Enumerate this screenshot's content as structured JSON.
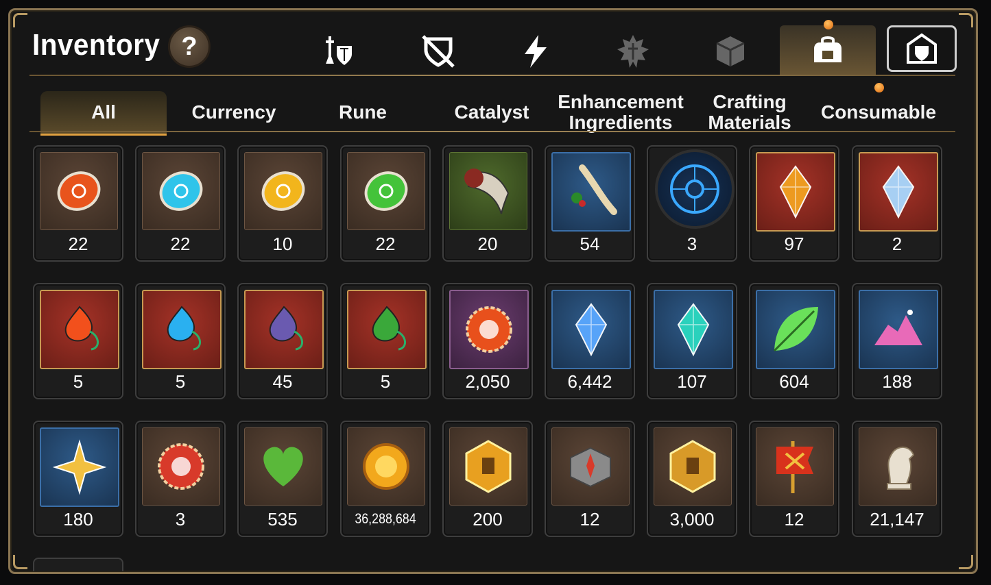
{
  "header": {
    "title": "Inventory",
    "help_label": "?",
    "icons": [
      {
        "name": "sword-shield-icon"
      },
      {
        "name": "broken-shield-icon"
      },
      {
        "name": "lightning-icon"
      },
      {
        "name": "spiked-emblem-icon"
      },
      {
        "name": "cube-icon"
      },
      {
        "name": "backpack-icon",
        "active": true,
        "badge": true
      },
      {
        "name": "castle-shield-icon"
      }
    ]
  },
  "tabs": [
    {
      "label": "All",
      "active": true
    },
    {
      "label": "Currency"
    },
    {
      "label": "Rune"
    },
    {
      "label": "Catalyst"
    },
    {
      "label": "Enhancement Ingredients"
    },
    {
      "label": "Crafting Materials"
    },
    {
      "label": "Consumable",
      "badge": true
    }
  ],
  "items": [
    {
      "name": "fire-rune-stone-icon",
      "qty": "22",
      "bg": "brown",
      "c": "#e8541c"
    },
    {
      "name": "ice-rune-stone-icon",
      "qty": "22",
      "bg": "brown",
      "c": "#2fc4ea"
    },
    {
      "name": "lightning-rune-stone-icon",
      "qty": "10",
      "bg": "brown",
      "c": "#f2b51c"
    },
    {
      "name": "wind-rune-stone-icon",
      "qty": "22",
      "bg": "brown",
      "c": "#44c33a"
    },
    {
      "name": "beast-claw-icon",
      "qty": "20",
      "bg": "green",
      "c": "#8a2a22"
    },
    {
      "name": "herb-root-icon",
      "qty": "54",
      "bg": "blue",
      "c": "#e8d8b0"
    },
    {
      "name": "rune-circle-icon",
      "qty": "3",
      "bg": "round",
      "c": "#3aa8ff"
    },
    {
      "name": "amber-crystal-icon",
      "qty": "97",
      "bg": "red",
      "c": "#f2a020"
    },
    {
      "name": "prism-crystal-icon",
      "qty": "2",
      "bg": "red",
      "c": "#a8d8ff"
    },
    {
      "name": "fire-amulet-icon",
      "qty": "5",
      "bg": "red",
      "c": "#f2501c"
    },
    {
      "name": "water-amulet-icon",
      "qty": "5",
      "bg": "red",
      "c": "#2ab0f0"
    },
    {
      "name": "void-amulet-icon",
      "qty": "45",
      "bg": "red",
      "c": "#6a5ab0"
    },
    {
      "name": "clover-amulet-icon",
      "qty": "5",
      "bg": "red",
      "c": "#3aa83a"
    },
    {
      "name": "flower-ring-icon",
      "qty": "2,050",
      "bg": "purple",
      "c": "#e8501c"
    },
    {
      "name": "blue-gem-icon",
      "qty": "6,442",
      "bg": "blue",
      "c": "#5aa8ff"
    },
    {
      "name": "teal-crystal-icon",
      "qty": "107",
      "bg": "blue",
      "c": "#2ad8c0"
    },
    {
      "name": "green-leaf-icon",
      "qty": "604",
      "bg": "blue",
      "c": "#6ae05a"
    },
    {
      "name": "pink-ore-icon",
      "qty": "188",
      "bg": "blue",
      "c": "#e86ab8"
    },
    {
      "name": "star-pendant-icon",
      "qty": "180",
      "bg": "blue",
      "c": "#f2c040"
    },
    {
      "name": "crest-seal-icon",
      "qty": "3",
      "bg": "brown",
      "c": "#d83a2a"
    },
    {
      "name": "green-heart-icon",
      "qty": "535",
      "bg": "brown",
      "c": "#5ab83a"
    },
    {
      "name": "gold-coin-icon",
      "qty": "36,288,684",
      "bg": "brown",
      "c": "#f2a81c",
      "small": true
    },
    {
      "name": "gold-hexagon-badge-icon",
      "qty": "200",
      "bg": "brown",
      "c": "#e8a020"
    },
    {
      "name": "stone-compass-icon",
      "qty": "12",
      "bg": "brown",
      "c": "#8a8a8a"
    },
    {
      "name": "fist-emblem-icon",
      "qty": "3,000",
      "bg": "brown",
      "c": "#d89a28"
    },
    {
      "name": "war-banner-icon",
      "qty": "12",
      "bg": "brown",
      "c": "#d8321c"
    },
    {
      "name": "chess-knight-icon",
      "qty": "21,147",
      "bg": "brown",
      "c": "#e8e0d0"
    }
  ]
}
